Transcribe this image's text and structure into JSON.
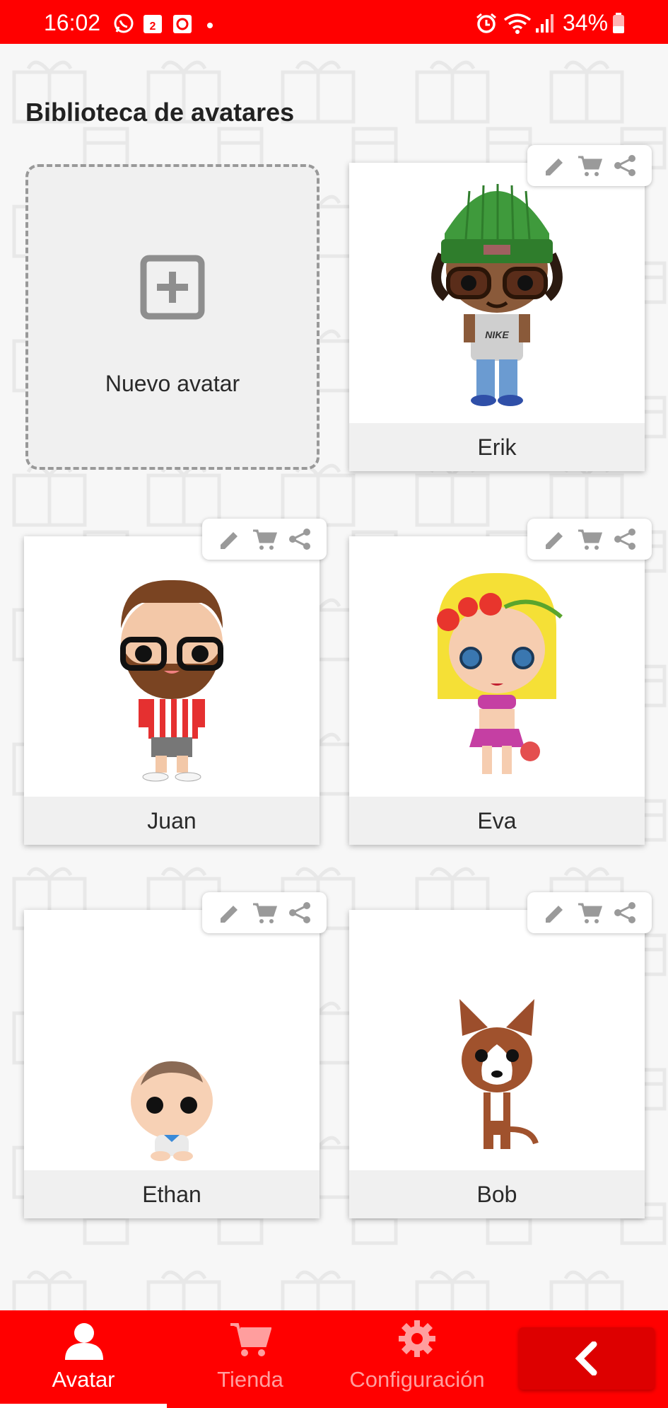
{
  "status_bar": {
    "time": "16:02",
    "battery": "34%",
    "calendar_day": "2"
  },
  "page": {
    "title": "Biblioteca de avatares"
  },
  "new_avatar": {
    "label": "Nuevo avatar"
  },
  "avatars": [
    {
      "name": "Erik"
    },
    {
      "name": "Juan"
    },
    {
      "name": "Eva"
    },
    {
      "name": "Ethan"
    },
    {
      "name": "Bob"
    }
  ],
  "card_tools": [
    "pencil-icon",
    "cart-icon",
    "share-icon"
  ],
  "bottom_nav": {
    "items": [
      {
        "label": "Avatar",
        "icon": "person-icon",
        "active": true
      },
      {
        "label": "Tienda",
        "icon": "cart-icon",
        "active": false
      },
      {
        "label": "Configuración",
        "icon": "gear-icon",
        "active": false
      }
    ],
    "back_icon": "chevron-left-icon"
  },
  "colors": {
    "brand_red": "#ff0000",
    "inactive_nav": "#ff9e9e",
    "tool_gray": "#9a9a9a"
  }
}
